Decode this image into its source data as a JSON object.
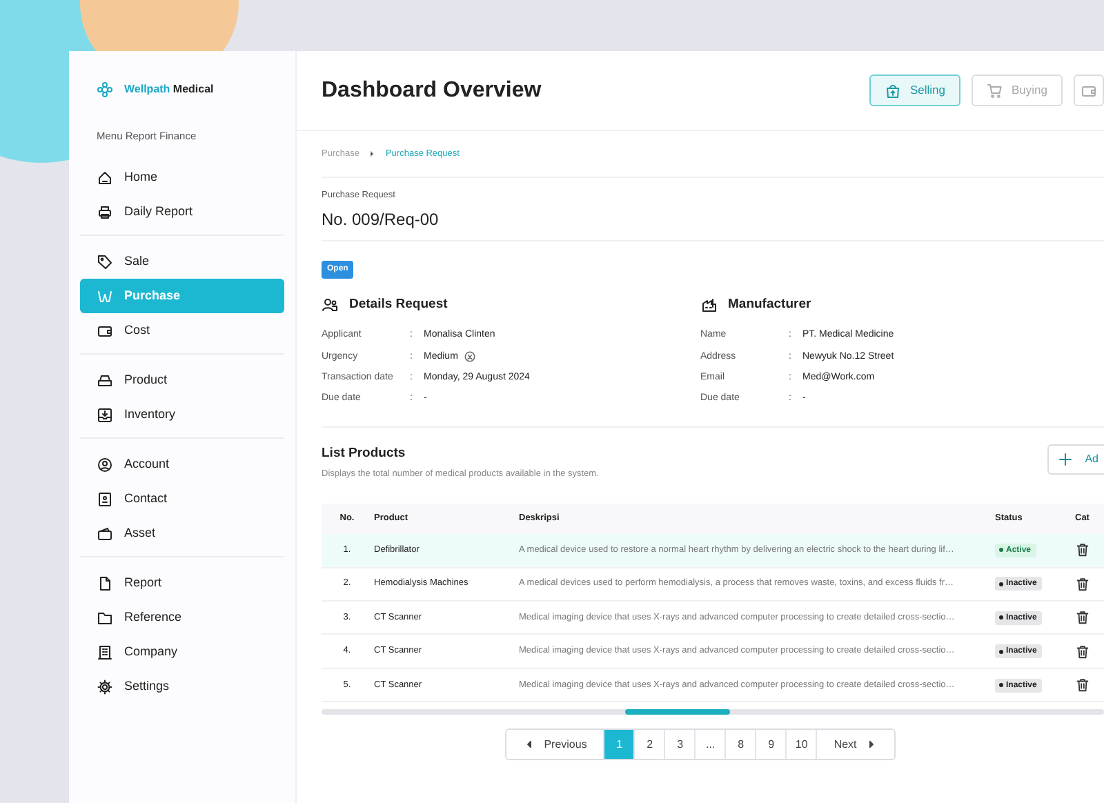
{
  "brand": {
    "name_part1": "Wellpath",
    "name_part2": "Medical"
  },
  "sidebar": {
    "heading": "Menu Report Finance",
    "groups": [
      {
        "items": [
          {
            "label": "Home",
            "selected": false
          },
          {
            "label": "Daily Report",
            "selected": false
          }
        ]
      },
      {
        "items": [
          {
            "label": "Sale",
            "selected": false
          },
          {
            "label": "Purchase",
            "selected": true
          },
          {
            "label": "Cost",
            "selected": false
          }
        ]
      },
      {
        "items": [
          {
            "label": "Product",
            "selected": false
          },
          {
            "label": "Inventory",
            "selected": false
          }
        ]
      },
      {
        "items": [
          {
            "label": "Account",
            "selected": false
          },
          {
            "label": "Contact",
            "selected": false
          },
          {
            "label": "Asset",
            "selected": false
          }
        ]
      },
      {
        "items": [
          {
            "label": "Report",
            "selected": false
          },
          {
            "label": "Reference",
            "selected": false
          },
          {
            "label": "Company",
            "selected": false
          },
          {
            "label": "Settings",
            "selected": false
          }
        ]
      }
    ]
  },
  "header": {
    "title": "Dashboard Overview",
    "tabs": [
      {
        "label": "Selling",
        "selected": true
      },
      {
        "label": "Buying",
        "selected": false
      },
      {
        "selected": false
      }
    ]
  },
  "breadcrumb": [
    {
      "label": "Purchase",
      "selected": false
    },
    {
      "label": "Purchase Request",
      "selected": true
    }
  ],
  "request": {
    "label": "Purchase Request",
    "number": "No. 009/Req-00",
    "status": "Open"
  },
  "sections": [
    {
      "title": "Details Request",
      "fields": [
        {
          "label": "Applicant",
          "colon": ":",
          "value": "Monalisa Clinten"
        },
        {
          "label": "Urgency",
          "colon": ":",
          "value": "Medium",
          "has_icon": true
        },
        {
          "label": "Transaction date",
          "colon": ":",
          "value": "Monday, 29 August 2024"
        },
        {
          "label": "Due date",
          "colon": ":",
          "value": "-"
        }
      ]
    },
    {
      "title": "Manufacturer",
      "fields": [
        {
          "label": "Name",
          "colon": ":",
          "value": "PT. Medical Medicine"
        },
        {
          "label": "Address",
          "colon": ":",
          "value": "Newyuk No.12 Street"
        },
        {
          "label": "Email",
          "colon": ":",
          "value": "Med@Work.com"
        },
        {
          "label": "Due date",
          "colon": ":",
          "value": "-"
        }
      ]
    }
  ],
  "products": {
    "title": "List Products",
    "subtitle": "Displays the total number of medical products available in the system.",
    "add_button": "Ad",
    "columns": [
      "No.",
      "Product",
      "Deskripsi",
      "Status",
      "Cat"
    ],
    "rows": [
      {
        "no": "1.",
        "product": "Defibrillator",
        "description": "A medical device used to restore a normal heart rhythm by delivering an electric shock to the heart during lif…",
        "status": "Active",
        "active": true,
        "selected": true
      },
      {
        "no": "2.",
        "product": "Hemodialysis Machines",
        "description": "A medical devices used to perform hemodialysis, a process that removes waste, toxins, and excess fluids fr…",
        "status": "Inactive",
        "active": false,
        "selected": false
      },
      {
        "no": "3.",
        "product": "CT Scanner",
        "description": "Medical imaging device that uses X-rays and advanced computer processing to create detailed cross-sectio…",
        "status": "Inactive",
        "active": false,
        "selected": false
      },
      {
        "no": "4.",
        "product": "CT Scanner",
        "description": "Medical imaging device that uses X-rays and advanced computer processing to create detailed cross-sectio…",
        "status": "Inactive",
        "active": false,
        "selected": false
      },
      {
        "no": "5.",
        "product": "CT Scanner",
        "description": "Medical imaging device that uses X-rays and advanced computer processing to create detailed cross-sectio…",
        "status": "Inactive",
        "active": false,
        "selected": false
      }
    ]
  },
  "pagination": {
    "previous": "Previous",
    "next": "Next",
    "pages": [
      {
        "label": "1",
        "selected": true
      },
      {
        "label": "2",
        "selected": false
      },
      {
        "label": "3",
        "selected": false
      },
      {
        "label": "...",
        "selected": false
      },
      {
        "label": "8",
        "selected": false
      },
      {
        "label": "9",
        "selected": false
      },
      {
        "label": "10",
        "selected": false
      }
    ]
  }
}
